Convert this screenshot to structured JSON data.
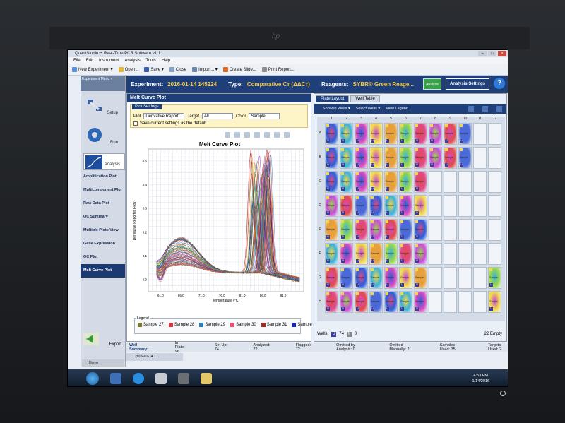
{
  "window": {
    "title": "QuantStudio™ Real-Time PCR Software v1.1",
    "close": "×",
    "min": "–",
    "max": "□"
  },
  "menu": [
    "File",
    "Edit",
    "Instrument",
    "Analysis",
    "Tools",
    "Help"
  ],
  "toolbar": {
    "new_experiment": "New Experiment ▾",
    "open": "Open...",
    "save": "Save ▾",
    "close": "Close",
    "import": "Import... ▾",
    "create_slide": "Create Slide...",
    "print_report": "Print Report..."
  },
  "nav": {
    "experiment_menu": "Experiment Menu «",
    "setup": "Setup",
    "run": "Run",
    "analysis": "Analysis",
    "items": [
      "Amplification Plot",
      "Multicomponent Plot",
      "Raw Data Plot",
      "QC Summary",
      "Multiple Plots View",
      "Gene Expression",
      "QC Plot",
      "Melt Curve Plot"
    ],
    "export": "Export",
    "home": "Home"
  },
  "header": {
    "experiment_label": "Experiment:",
    "experiment_value": "2016-01-14 145224",
    "type_label": "Type:",
    "type_value": "Comparative Cт (ΔΔCт)",
    "reagents_label": "Reagents:",
    "reagents_value": "SYBR® Green Reage...",
    "analyze": "Analyze",
    "analysis_settings": "Analysis Settings",
    "help": "?"
  },
  "melt_panel": {
    "title": "Melt Curve Plot",
    "plot_settings_tab": "Plot Settings",
    "plot_label": "Plot",
    "plot_value": "Derivative Report...",
    "target_label": "Target",
    "target_value": "All",
    "color_label": "Color",
    "color_value": "Sample",
    "save_default": "Save current settings as the default"
  },
  "chart_data": {
    "type": "line",
    "title": "Melt Curve Plot",
    "xlabel": "Temperature (°C)",
    "ylabel": "Derivative Reporter (-Rn')",
    "x_ticks": [
      "61.0",
      "66.0",
      "71.0",
      "76.0",
      "81.0",
      "86.0",
      "91.0"
    ],
    "y_ticks": [
      "0.0",
      "0.1",
      "0.2",
      "0.3",
      "0.4",
      "0.5"
    ],
    "xlim": [
      58,
      96
    ],
    "ylim": [
      -0.05,
      0.55
    ],
    "grid": true,
    "series_count": 72,
    "peak_range": [
      83,
      88
    ],
    "peak_height_range": [
      0.25,
      0.52
    ],
    "series_colors": [
      "#7a1f1f",
      "#d9363e",
      "#2a7fc0",
      "#e8507a",
      "#a42a2a",
      "#1026c9",
      "#2aa84a",
      "#f08a1c",
      "#8a2ac9",
      "#19b3b3",
      "#c9b019",
      "#555555"
    ]
  },
  "legend": {
    "title": "Legend",
    "items": [
      {
        "label": "Sample 27",
        "color": "#7a7a30"
      },
      {
        "label": "Sample 28",
        "color": "#d9363e"
      },
      {
        "label": "Sample 29",
        "color": "#2a7fc0"
      },
      {
        "label": "Sample 30",
        "color": "#e8507a"
      },
      {
        "label": "Sample 31",
        "color": "#a42a2a"
      },
      {
        "label": "Sample 3...",
        "color": "#1026c9"
      }
    ]
  },
  "plate": {
    "tabs": [
      "Plate Layout",
      "Well Table"
    ],
    "show_in_wells": "Show in Wells ▾",
    "select_wells": "Select Wells ▾",
    "view_legend": "View Legend",
    "columns": [
      "1",
      "2",
      "3",
      "4",
      "5",
      "6",
      "7",
      "8",
      "9",
      "10",
      "11",
      "12"
    ],
    "rows": [
      "A",
      "B",
      "C",
      "D",
      "E",
      "F",
      "G",
      "H"
    ],
    "well_label": "Sample",
    "wells_label": "Wells:",
    "wells_u": "74",
    "wells_other": "0",
    "empty": "22 Empty"
  },
  "well_summary": {
    "label": "Well Summary:",
    "in_plate": "In Plate: 96",
    "set_up": "Set Up: 74",
    "analyzed": "Analyzed: 72",
    "flagged": "Flagged: 72",
    "omitted_analysis": "Omitted by Analysis: 0",
    "omitted_manually": "Omitted Manually: 2",
    "samples_used": "Samples Used: 35",
    "targets_used": "Targets Used: 2"
  },
  "doc_tab": "2016-01-14 1...",
  "clock": {
    "time": "4:53 PM",
    "date": "1/14/2016"
  }
}
